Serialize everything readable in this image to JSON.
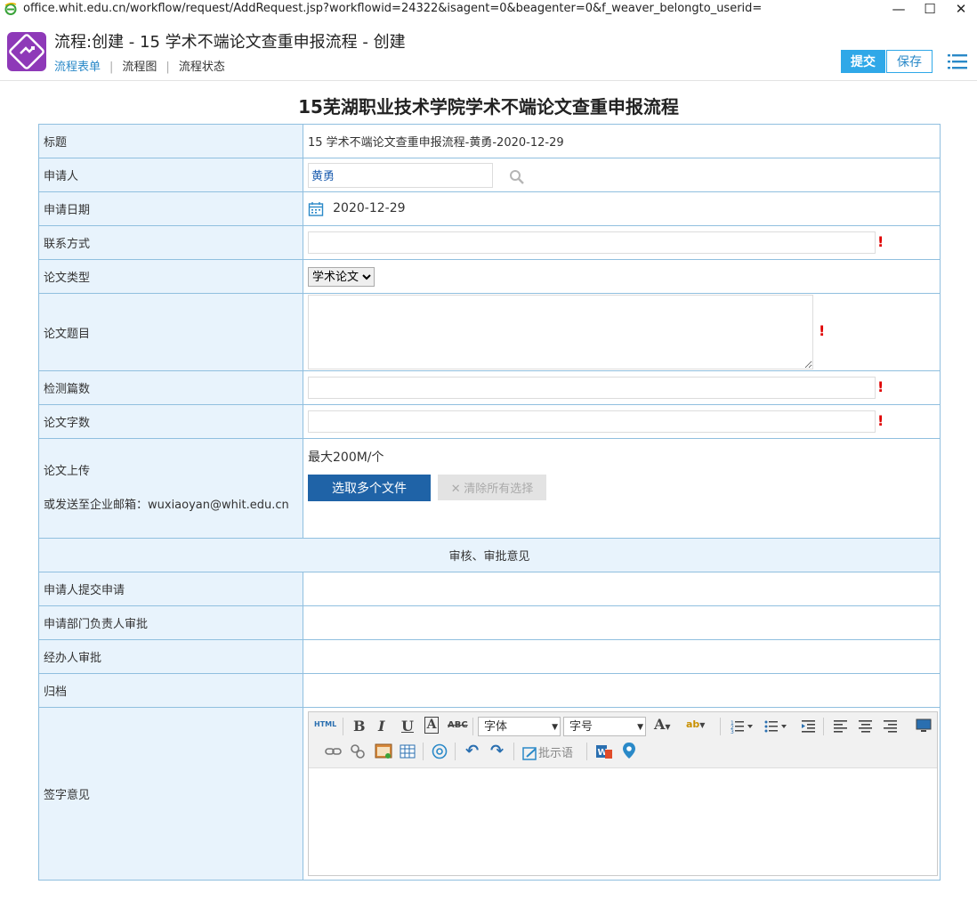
{
  "browser": {
    "url": "office.whit.edu.cn/workflow/request/AddRequest.jsp?workflowid=24322&isagent=0&beagenter=0&f_weaver_belongto_userid="
  },
  "header": {
    "title": "流程:创建 - 15 学术不端论文查重申报流程 - 创建",
    "tabs": [
      "流程表单",
      "流程图",
      "流程状态"
    ],
    "submit_label": "提交",
    "save_label": "保存"
  },
  "form": {
    "title": "15芜湖职业技术学院学术不端论文查重申报流程",
    "fields": {
      "title_label": "标题",
      "title_value": "15 学术不端论文查重申报流程-黄勇-2020-12-29",
      "applicant_label": "申请人",
      "applicant_value": "黄勇",
      "date_label": "申请日期",
      "date_value": "2020-12-29",
      "contact_label": "联系方式",
      "type_label": "论文类型",
      "type_value": "学术论文",
      "topic_label": "论文题目",
      "count_label": "检测篇数",
      "words_label": "论文字数",
      "upload_label": "论文上传",
      "upload_email_note": "或发送至企业邮箱：wuxiaoyan@whit.edu.cn",
      "upload_limit": "最大200M/个",
      "upload_button": "选取多个文件",
      "clear_button": "清除所有选择"
    },
    "approval": {
      "section_title": "审核、审批意见",
      "rows": [
        "申请人提交申请",
        "申请部门负责人审批",
        "经办人审批",
        "归档"
      ],
      "signature_label": "签字意见"
    },
    "editor": {
      "font_placeholder": "字体",
      "size_placeholder": "字号",
      "phrase_label": "批示语"
    }
  },
  "colors": {
    "accent": "#2fa8e8",
    "label_bg": "#e8f3fc",
    "border": "#90bfdf",
    "upload_btn": "#1f63a7",
    "app_icon": "#8e39b8",
    "required": "#e00000"
  }
}
